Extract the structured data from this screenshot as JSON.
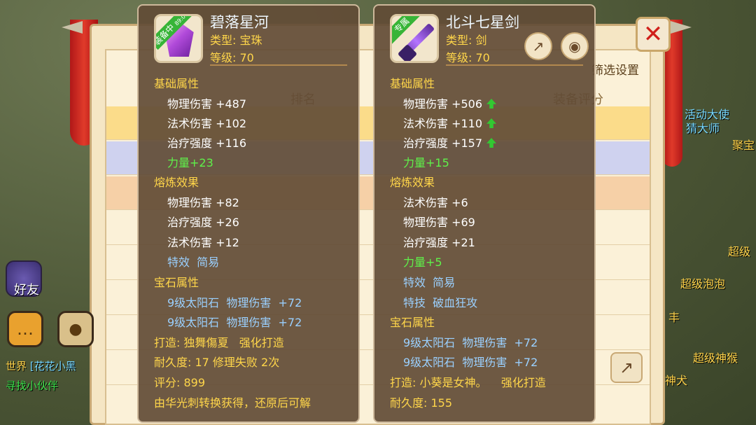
{
  "background": {
    "filter_label": "筛选设置",
    "score_header": "装备评分",
    "rank_header": "排名",
    "right_hud": [
      "活动大使",
      "猜大师",
      "聚宝",
      "超级",
      "超级泡泡",
      "丰",
      "超级神猴",
      "神犬"
    ],
    "world_prefix": "世界",
    "world_message": "[花花小黑",
    "find_partner": "寻找小伙伴"
  },
  "hud": {
    "friends_label": "好友"
  },
  "colors": {
    "panel_bg": "#624c36",
    "section": "#ffd64a",
    "bonus": "#5ff24a",
    "gem": "#9ad0ff"
  },
  "left_item": {
    "badge": "装备中",
    "badge_sub": "89:00",
    "name": "碧落星河",
    "type": "类型: 宝珠",
    "level": "等级: 70",
    "base_title": "基础属性",
    "base_stats": [
      "物理伤害 +487",
      "法术伤害 +102",
      "治疗强度 +116"
    ],
    "base_bonus": "力量+23",
    "refine_title": "熔炼效果",
    "refine_stats": [
      "物理伤害 +82",
      "治疗强度 +26",
      "法术伤害 +12"
    ],
    "special": "特效  简易",
    "gem_title": "宝石属性",
    "gems": [
      "9级太阳石  物理伤害  +72",
      "9级太阳石  物理伤害  +72"
    ],
    "forge": "打造: 独舞傷夏   强化打造",
    "durability": "耐久度: 17 修理失败 2次",
    "score": "评分: 899",
    "source": "由华光刺转换获得，还原后可解"
  },
  "right_item": {
    "badge": "专属",
    "name": "北斗七星剑",
    "type": "类型: 剑",
    "level": "等级: 70",
    "base_title": "基础属性",
    "base_stats": [
      "物理伤害 +506",
      "法术伤害 +110",
      "治疗强度 +157"
    ],
    "base_bonus": "力量+15",
    "refine_title": "熔炼效果",
    "refine_stats": [
      "法术伤害 +6",
      "物理伤害 +69",
      "治疗强度 +21"
    ],
    "refine_bonus": "力量+5",
    "special": "特效  简易",
    "skill": "特技  破血狂攻",
    "gem_title": "宝石属性",
    "gems": [
      "9级太阳石  物理伤害  +72",
      "9级太阳石  物理伤害  +72"
    ],
    "forge": "打造: 小葵是女神。    强化打造",
    "durability": "耐久度: 155"
  }
}
